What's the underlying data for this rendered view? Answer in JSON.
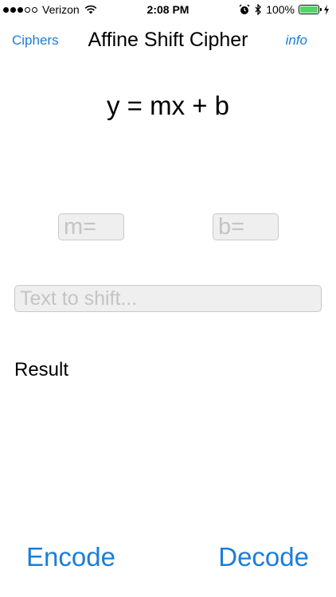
{
  "status_bar": {
    "carrier": "Verizon",
    "time": "2:08 PM",
    "battery": "100%",
    "icons": [
      "signal-dots",
      "wifi-icon",
      "alarm-icon",
      "bluetooth-icon",
      "battery-icon",
      "charging-icon"
    ],
    "battery_level": 1.0,
    "battery_color": "#4cd964"
  },
  "nav": {
    "back_label": "Ciphers",
    "title": "Affine Shift Cipher",
    "info_label": "info",
    "accent": "#1a7ed8"
  },
  "formula": "y = mx + b",
  "inputs": {
    "m_placeholder": "m=",
    "b_placeholder": "b=",
    "text_placeholder": "Text to shift...",
    "m_value": "",
    "b_value": "",
    "text_value": ""
  },
  "result_label": "Result",
  "actions": {
    "encode_label": "Encode",
    "decode_label": "Decode"
  }
}
